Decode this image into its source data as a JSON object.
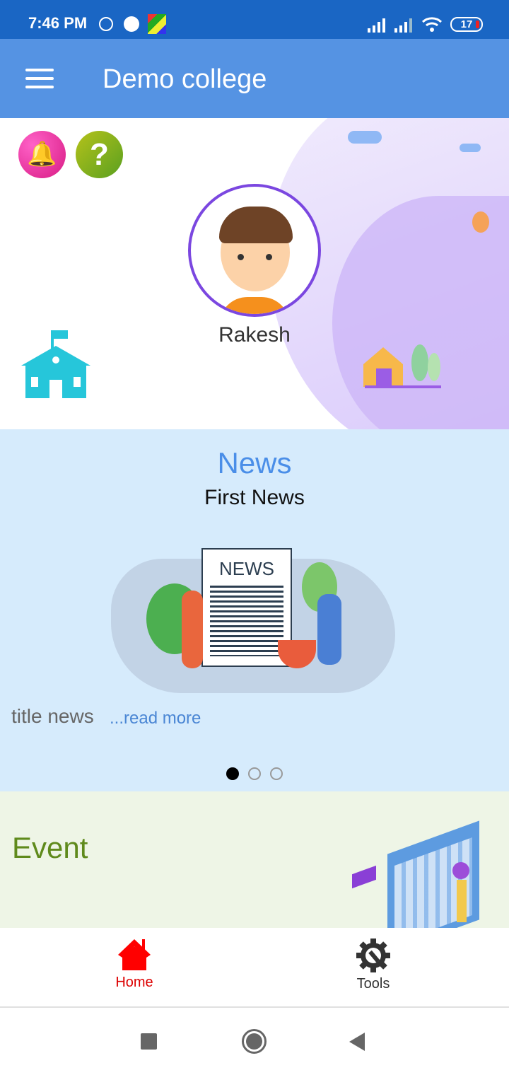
{
  "status_bar": {
    "time": "7:46 PM",
    "battery": "17",
    "icons": [
      "alarm-icon",
      "jio-icon",
      "ludo-app-icon",
      "signal-icon",
      "signal-icon",
      "wifi-icon",
      "battery-icon"
    ]
  },
  "app_bar": {
    "title": "Demo college",
    "menu_icon": "hamburger-icon"
  },
  "profile": {
    "name": "Rakesh"
  },
  "news": {
    "heading": "News",
    "item_title": "First News",
    "illustration_label": "NEWS",
    "summary": "title news",
    "read_more": "...read more",
    "pages": 3,
    "active_page": 1
  },
  "event": {
    "heading": "Event"
  },
  "bottom_nav": {
    "items": [
      {
        "label": "Home",
        "icon": "home-icon",
        "active": true
      },
      {
        "label": "Tools",
        "icon": "gear-wrench-icon",
        "active": false
      }
    ]
  },
  "colors": {
    "status_bar": "#1a66c4",
    "app_bar": "#5593e3",
    "news_bg": "#d6ebfc",
    "news_heading": "#4a8ee8",
    "event_bg": "#eef5e6",
    "event_heading": "#5f8a1c",
    "active_nav": "#e00000"
  }
}
